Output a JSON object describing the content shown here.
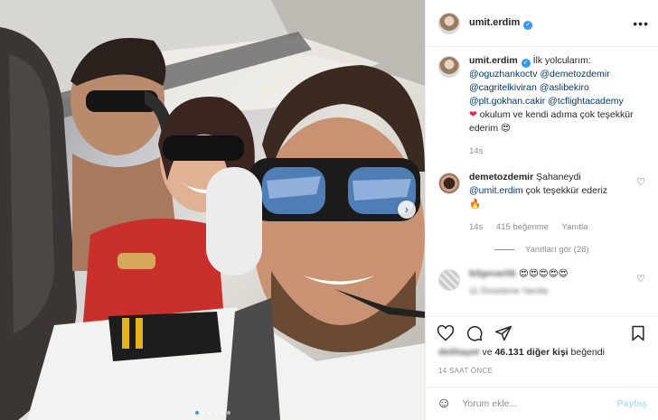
{
  "post": {
    "username": "umit.erdim",
    "more_icon": "ellipsis-icon",
    "photo": {
      "dots": 6,
      "active_dot": 0,
      "next_icon": "chevron-right-icon"
    }
  },
  "caption": {
    "username": "umit.erdim",
    "text_intro": "İlk yolcularım:",
    "mentions": [
      "@oguzhankoctv",
      "@demetozdemir",
      "@cagritelkiviran",
      "@aslibekiro",
      "@plt.gokhan.cakir",
      "@tcflightacademy"
    ],
    "text_outro": "okulum ve kendi adıma çok teşekkür ederim",
    "age": "14s"
  },
  "comment1": {
    "username": "demetozdemir",
    "text": "Şahaneydi",
    "mention": "@umit.erdim",
    "text2": "çok teşekkür ederiz",
    "age": "14s",
    "likes": "415 beğenme",
    "reply": "Yanıtla",
    "view_replies": "Yanıtları gör (26)"
  },
  "comment2": {
    "username": "bilgevarlik",
    "text": "😍😍😍😍😍",
    "meta": "11 Önceleme  Yanıtla"
  },
  "footer": {
    "likes_user": "delihayet",
    "likes_text": "ve",
    "likes_count": "46.131 diğer kişi",
    "likes_suffix": "beğendi",
    "timestamp": "14 SAAT ÖNCE",
    "comment_placeholder": "Yorum ekle...",
    "post_label": "Paylaş"
  },
  "colors": {
    "link": "#00376b",
    "accent": "#3897f0",
    "muted": "#8e8e8e"
  }
}
